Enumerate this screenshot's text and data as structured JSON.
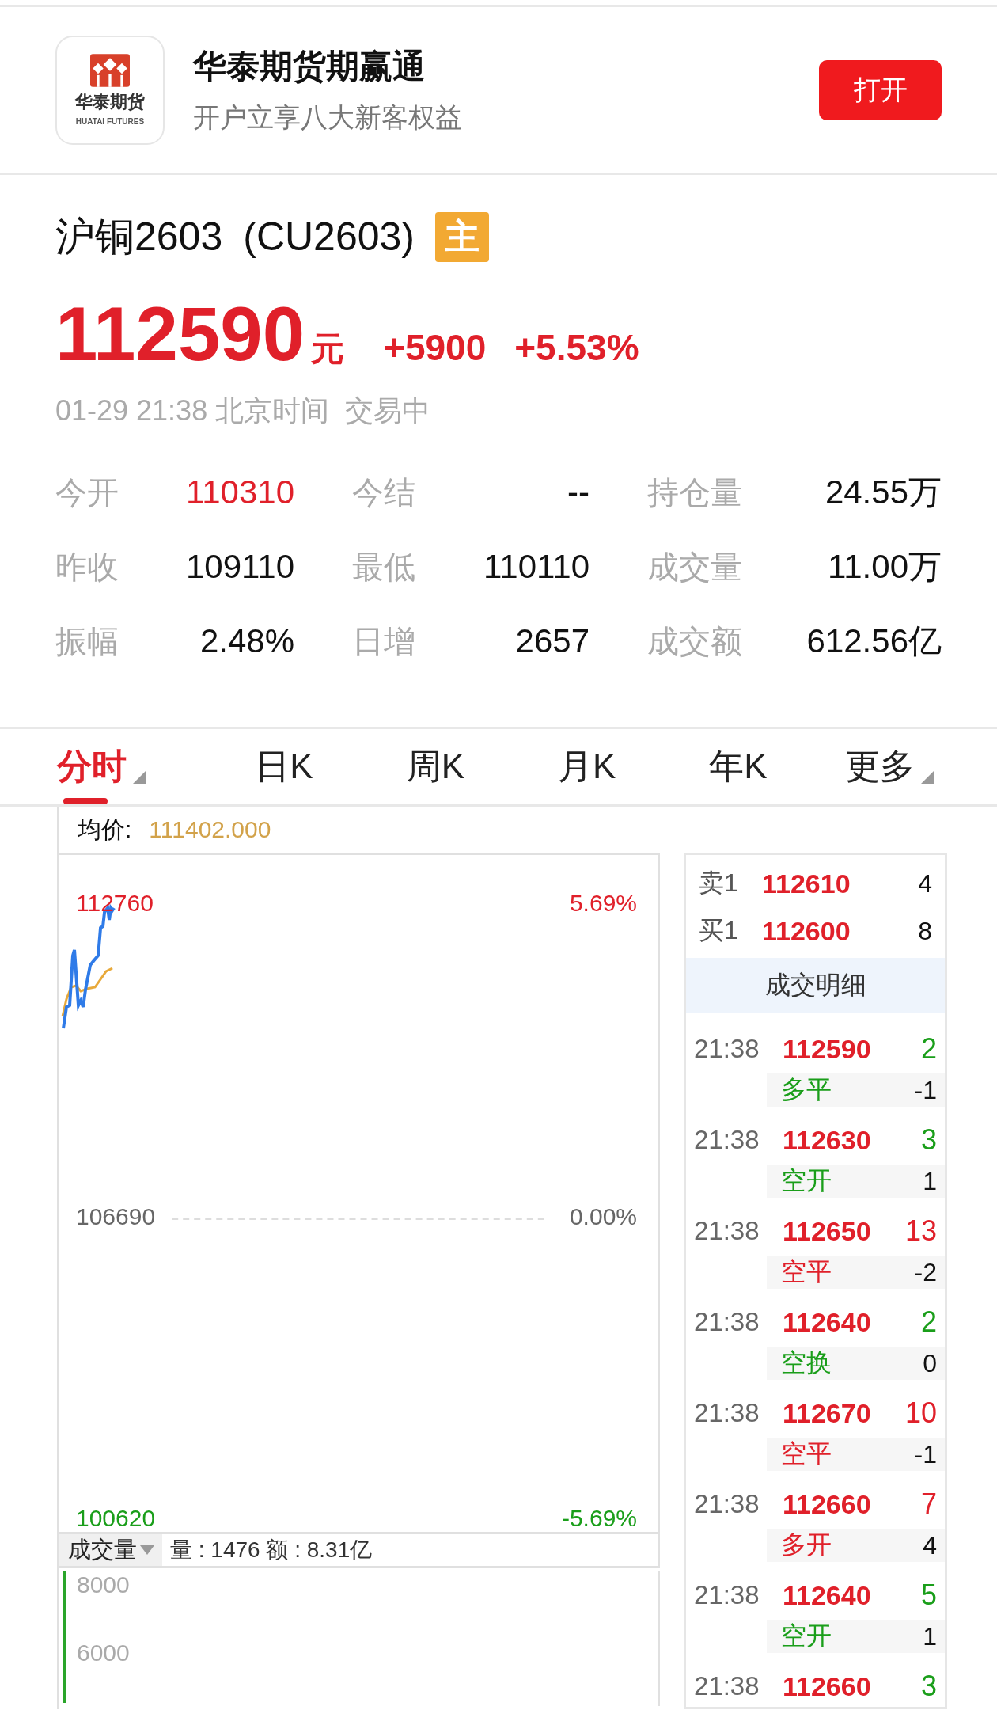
{
  "app_banner": {
    "logo_name": "华泰期货",
    "logo_subtitle": "HUATAI FUTURES",
    "title": "华泰期货期赢通",
    "subtitle": "开户立享八大新客权益",
    "button": "打开"
  },
  "quote": {
    "name": "沪铜2603",
    "code": "(CU2603)",
    "badge": "主",
    "price": "112590",
    "unit": "元",
    "change": "+5900",
    "change_pct": "+5.53%",
    "time": "01-29 21:38 北京时间",
    "status": "交易中"
  },
  "stats": [
    {
      "label": "今开",
      "value": "110310",
      "rising": true
    },
    {
      "label": "今结",
      "value": "--",
      "rising": false
    },
    {
      "label": "持仓量",
      "value": "24.55万",
      "rising": false
    },
    {
      "label": "昨收",
      "value": "109110",
      "rising": false
    },
    {
      "label": "最低",
      "value": "110110",
      "rising": false
    },
    {
      "label": "成交量",
      "value": "11.00万",
      "rising": false
    },
    {
      "label": "振幅",
      "value": "2.48%",
      "rising": false
    },
    {
      "label": "日增",
      "value": "2657",
      "rising": false
    },
    {
      "label": "成交额",
      "value": "612.56亿",
      "rising": false
    }
  ],
  "tabs": [
    {
      "label": "分时",
      "selected": true,
      "has_menu": true
    },
    {
      "label": "日K",
      "selected": false,
      "has_menu": false
    },
    {
      "label": "周K",
      "selected": false,
      "has_menu": false
    },
    {
      "label": "月K",
      "selected": false,
      "has_menu": false
    },
    {
      "label": "年K",
      "selected": false,
      "has_menu": false
    },
    {
      "label": "更多",
      "selected": false,
      "has_menu": true
    }
  ],
  "chart": {
    "avg_label": "均价:",
    "avg_value": "111402.000",
    "price_high": "112760",
    "pct_high": "5.69%",
    "price_mid": "106690",
    "pct_mid": "0.00%",
    "price_low": "100620",
    "pct_low": "-5.69%"
  },
  "volume": {
    "selector": "成交量",
    "summary": "量 : 1476 额 : 8.31亿",
    "ticks": [
      "8000",
      "6000"
    ]
  },
  "order_book": [
    {
      "label": "卖1",
      "price": "112610",
      "qty": "4"
    },
    {
      "label": "买1",
      "price": "112600",
      "qty": "8"
    }
  ],
  "trades_title": "成交明细",
  "trades": [
    {
      "time": "21:38",
      "price": "112590",
      "volume": "2",
      "volume_rising": false,
      "action": "多平",
      "action_rising": false,
      "change": "-1"
    },
    {
      "time": "21:38",
      "price": "112630",
      "volume": "3",
      "volume_rising": false,
      "action": "空开",
      "action_rising": false,
      "change": "1"
    },
    {
      "time": "21:38",
      "price": "112650",
      "volume": "13",
      "volume_rising": true,
      "action": "空平",
      "action_rising": true,
      "change": "-2"
    },
    {
      "time": "21:38",
      "price": "112640",
      "volume": "2",
      "volume_rising": false,
      "action": "空换",
      "action_rising": false,
      "change": "0"
    },
    {
      "time": "21:38",
      "price": "112670",
      "volume": "10",
      "volume_rising": true,
      "action": "空平",
      "action_rising": true,
      "change": "-1"
    },
    {
      "time": "21:38",
      "price": "112660",
      "volume": "7",
      "volume_rising": true,
      "action": "多开",
      "action_rising": true,
      "change": "4"
    },
    {
      "time": "21:38",
      "price": "112640",
      "volume": "5",
      "volume_rising": false,
      "action": "空开",
      "action_rising": false,
      "change": "1"
    },
    {
      "time": "21:38",
      "price": "112660",
      "volume": "3",
      "volume_rising": false
    }
  ]
}
